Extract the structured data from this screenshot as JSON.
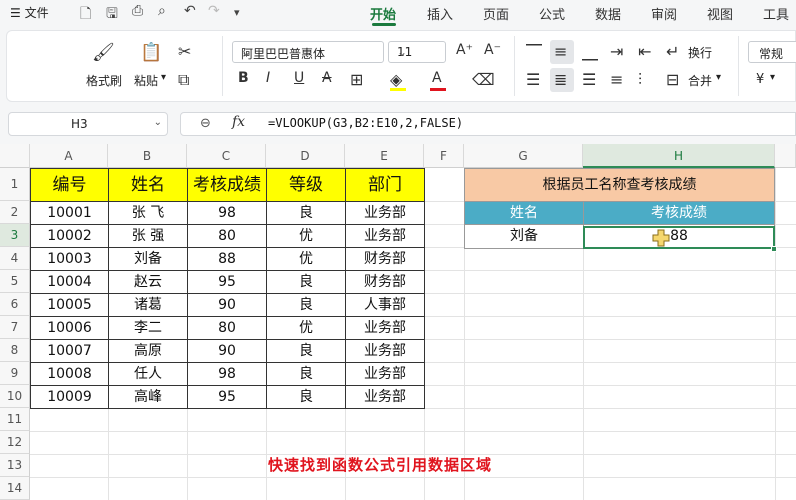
{
  "menubar": {
    "menu_icon": "hamburger-icon",
    "file_label": "文件",
    "tabs": [
      {
        "label": "开始",
        "active": true
      },
      {
        "label": "插入",
        "active": false
      },
      {
        "label": "页面",
        "active": false
      },
      {
        "label": "公式",
        "active": false
      },
      {
        "label": "数据",
        "active": false
      },
      {
        "label": "审阅",
        "active": false
      },
      {
        "label": "视图",
        "active": false
      },
      {
        "label": "工具",
        "active": false
      }
    ],
    "accent_color": "#1b7a3e"
  },
  "ribbon": {
    "format_painter_label": "格式刷",
    "paste_label": "粘贴",
    "font_name": "阿里巴巴普惠体",
    "font_size": "11",
    "wrap_label": "换行",
    "merge_label": "合并",
    "number_format": "常规",
    "currency_symbol": "¥"
  },
  "formula_bar": {
    "cell_ref": "H3",
    "fx_label": "fx",
    "formula": "=VLOOKUP(G3,B2:E10,2,FALSE)"
  },
  "columns": [
    "A",
    "B",
    "C",
    "D",
    "E",
    "F",
    "G",
    "H"
  ],
  "rows": [
    "1",
    "2",
    "3",
    "4",
    "5",
    "6",
    "7",
    "8",
    "9",
    "10",
    "11",
    "12",
    "13",
    "14"
  ],
  "table": {
    "headers": [
      "编号",
      "姓名",
      "考核成绩",
      "等级",
      "部门"
    ],
    "rows": [
      [
        "10001",
        "张 飞",
        "98",
        "良",
        "业务部"
      ],
      [
        "10002",
        "张 强",
        "80",
        "优",
        "业务部"
      ],
      [
        "10003",
        "刘备",
        "88",
        "优",
        "财务部"
      ],
      [
        "10004",
        "赵云",
        "95",
        "良",
        "财务部"
      ],
      [
        "10005",
        "诸葛",
        "90",
        "良",
        "人事部"
      ],
      [
        "10006",
        "李二",
        "80",
        "优",
        "业务部"
      ],
      [
        "10007",
        "高原",
        "90",
        "良",
        "业务部"
      ],
      [
        "10008",
        "任人",
        "98",
        "良",
        "业务部"
      ],
      [
        "10009",
        "高峰",
        "95",
        "良",
        "业务部"
      ]
    ],
    "header_color": "#ffff00"
  },
  "lookup": {
    "title": "根据员工名称查考核成绩",
    "name_header": "姓名",
    "score_header": "考核成绩",
    "name_value": "刘备",
    "score_value": "88",
    "title_color": "#f8c9a5",
    "header_color": "#4bacc6"
  },
  "caption": "快速找到函数公式引用数据区域"
}
